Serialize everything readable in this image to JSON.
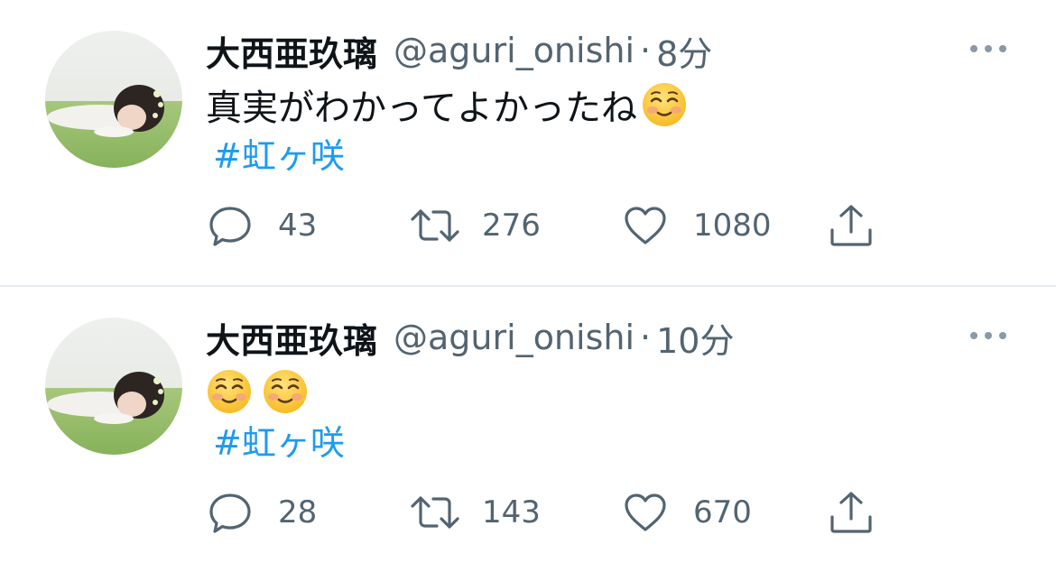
{
  "tweets": [
    {
      "name": "大西亜玖璃",
      "handle": "@aguri_onishi",
      "separator": "·",
      "time": "8分",
      "text": "真実がわかってよかったね",
      "emojis": [
        "smiling-face-icon"
      ],
      "hashtag": "#虹ヶ咲",
      "replies": "43",
      "retweets": "276",
      "likes": "1080"
    },
    {
      "name": "大西亜玖璃",
      "handle": "@aguri_onishi",
      "separator": "·",
      "time": "10分",
      "text": "",
      "emojis": [
        "smiling-face-icon",
        "smiling-face-icon"
      ],
      "hashtag": "#虹ヶ咲",
      "replies": "28",
      "retweets": "143",
      "likes": "670"
    }
  ],
  "icons": {
    "reply": "reply-icon",
    "retweet": "retweet-icon",
    "like": "heart-icon",
    "share": "share-icon",
    "more": "more-icon"
  },
  "colors": {
    "text": "#0f1419",
    "secondary": "#536471",
    "link": "#1d9bf0",
    "divider": "#e6ecf0"
  }
}
